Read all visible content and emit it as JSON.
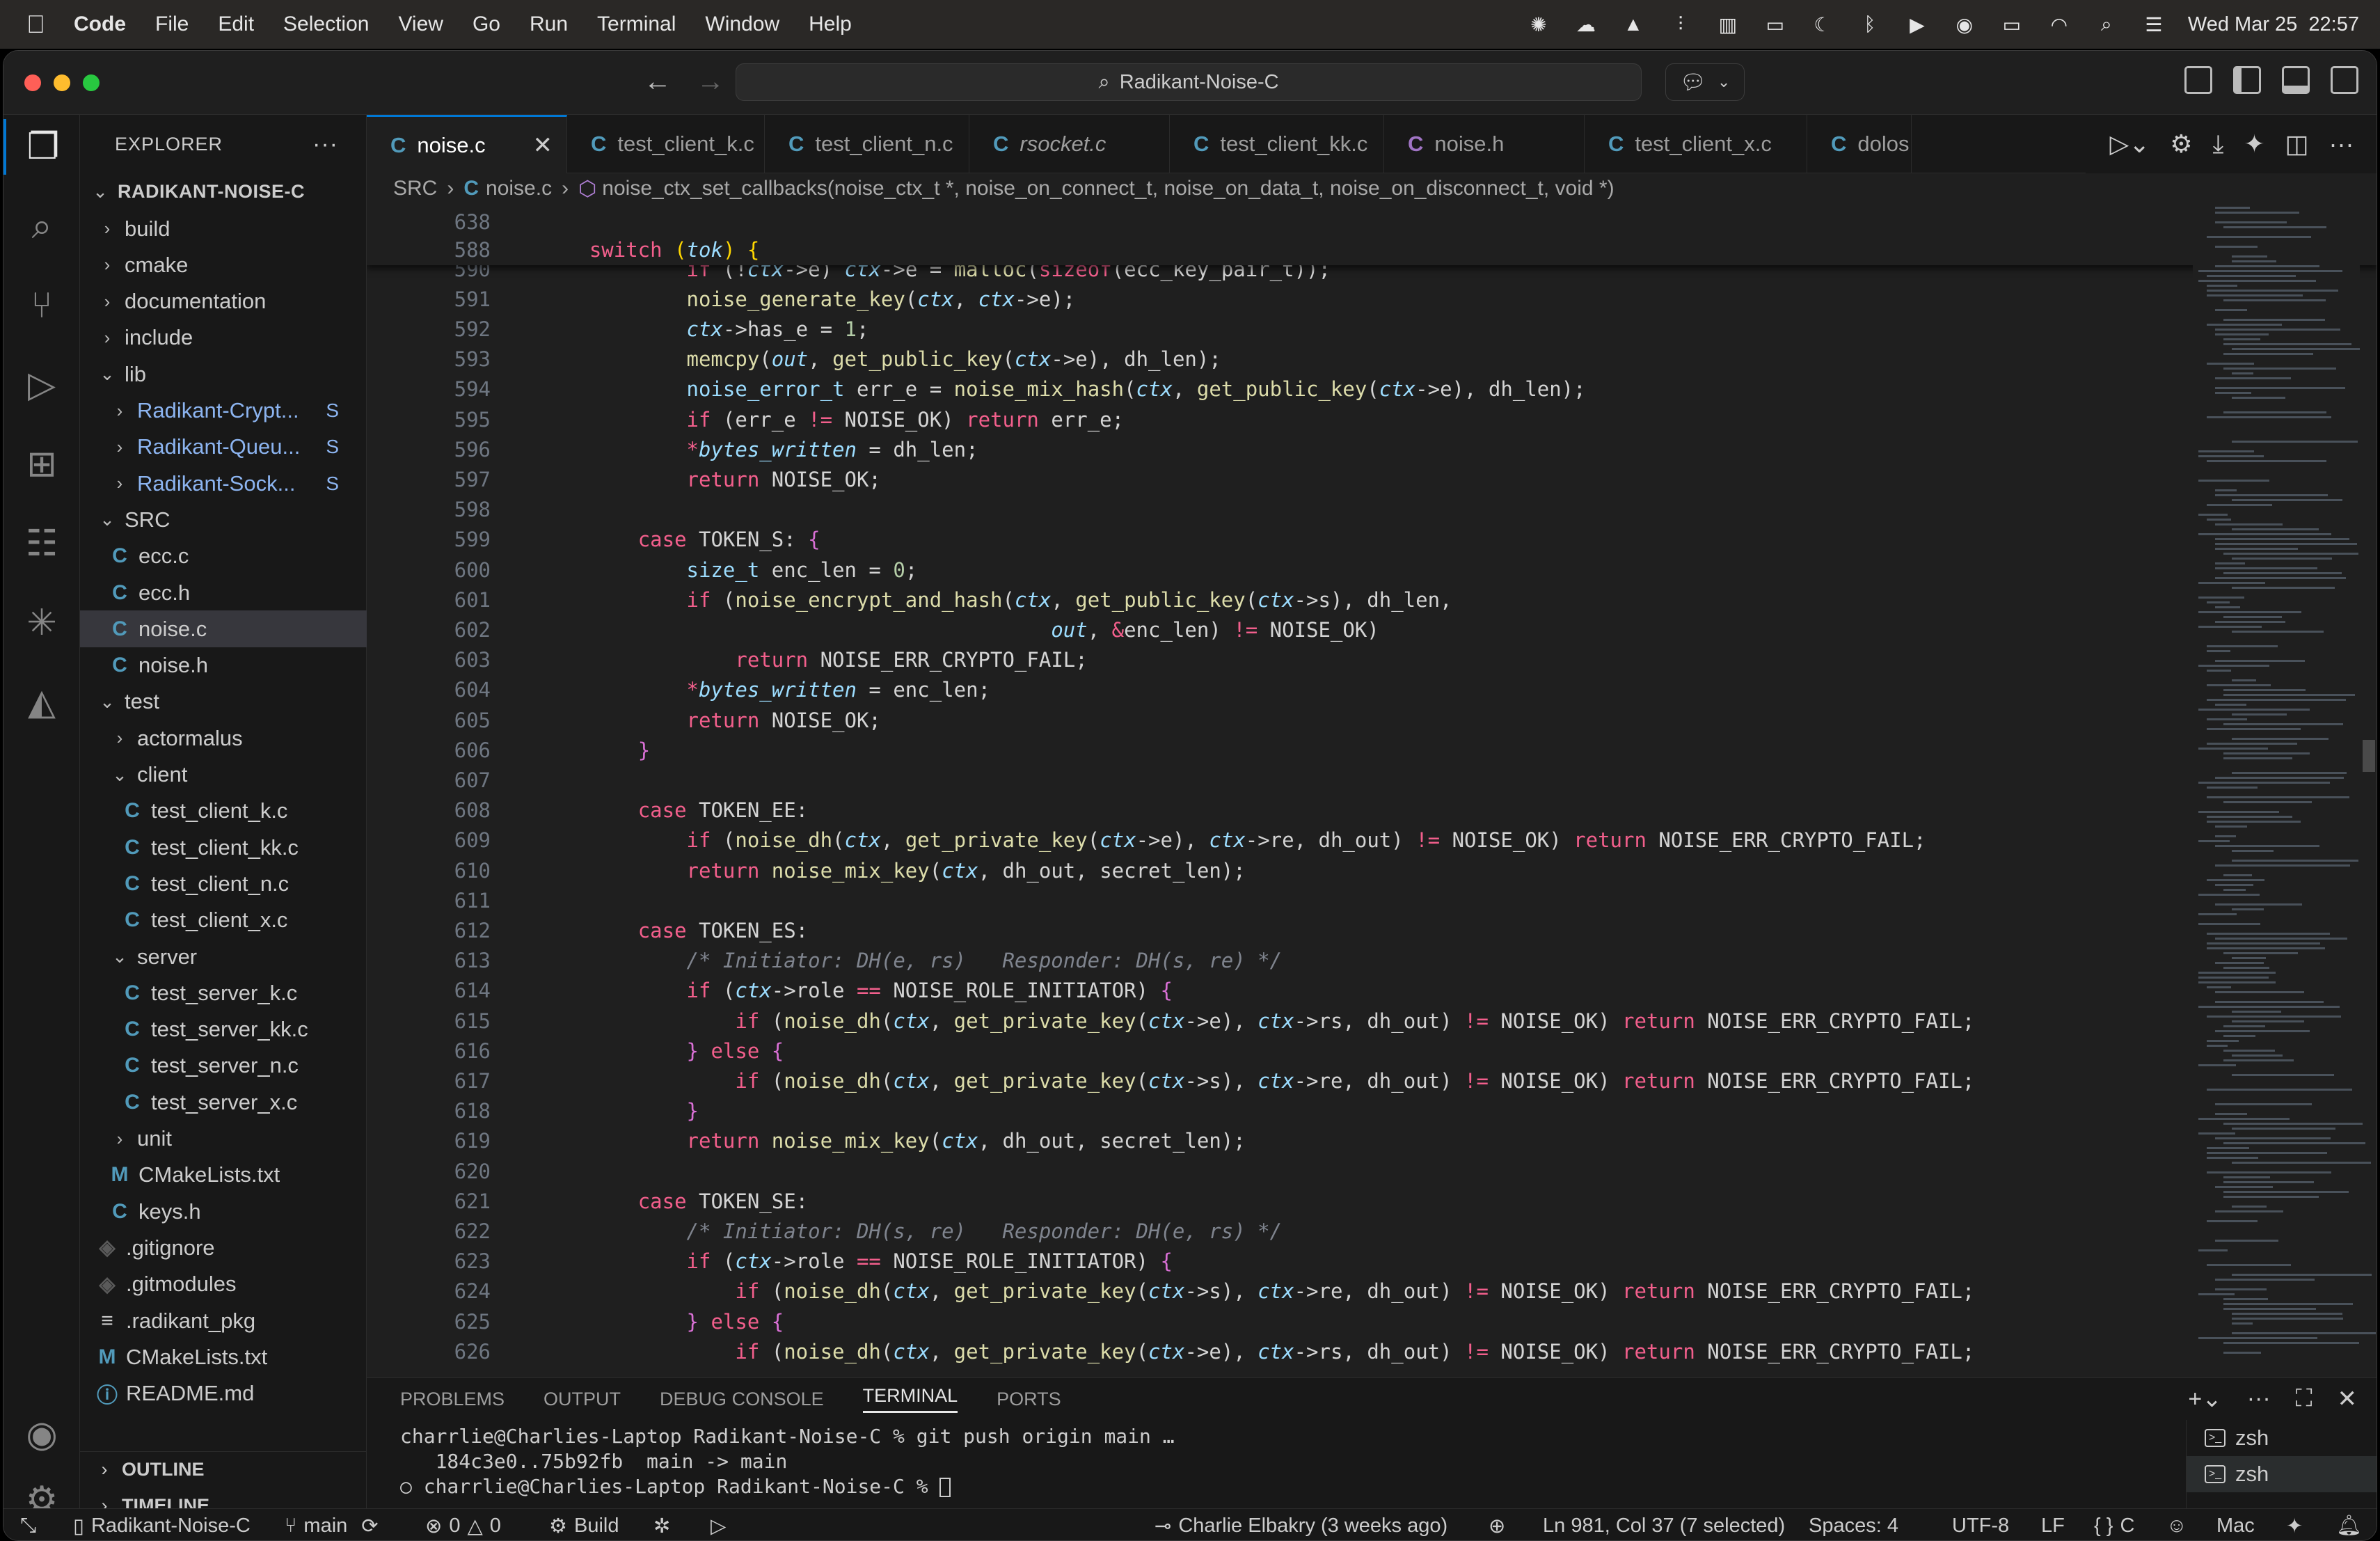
{
  "menubar": {
    "app": "Code",
    "items": [
      "File",
      "Edit",
      "Selection",
      "View",
      "Go",
      "Run",
      "Terminal",
      "Window",
      "Help"
    ],
    "datetime": "Wed Mar 25  22:57"
  },
  "titlebar": {
    "search_text": "Radikant-Noise-C"
  },
  "sidebar": {
    "title": "EXPLORER",
    "root": "RADIKANT-NOISE-C",
    "tree": [
      {
        "label": "build",
        "type": "folder",
        "depth": 0,
        "open": false
      },
      {
        "label": "cmake",
        "type": "folder",
        "depth": 0,
        "open": false
      },
      {
        "label": "documentation",
        "type": "folder",
        "depth": 0,
        "open": false
      },
      {
        "label": "include",
        "type": "folder",
        "depth": 0,
        "open": false
      },
      {
        "label": "lib",
        "type": "folder",
        "depth": 0,
        "open": true
      },
      {
        "label": "Radikant-Crypt...",
        "type": "submodule",
        "depth": 1,
        "open": false,
        "badge": "S"
      },
      {
        "label": "Radikant-Queu...",
        "type": "submodule",
        "depth": 1,
        "open": false,
        "badge": "S"
      },
      {
        "label": "Radikant-Sock...",
        "type": "submodule",
        "depth": 1,
        "open": false,
        "badge": "S"
      },
      {
        "label": "SRC",
        "type": "folder",
        "depth": 0,
        "open": true
      },
      {
        "label": "ecc.c",
        "type": "c",
        "depth": 1
      },
      {
        "label": "ecc.h",
        "type": "c",
        "depth": 1
      },
      {
        "label": "noise.c",
        "type": "c",
        "depth": 1,
        "selected": true
      },
      {
        "label": "noise.h",
        "type": "c",
        "depth": 1
      },
      {
        "label": "test",
        "type": "folder",
        "depth": 0,
        "open": true
      },
      {
        "label": "actormalus",
        "type": "folder",
        "depth": 1,
        "open": false
      },
      {
        "label": "client",
        "type": "folder",
        "depth": 1,
        "open": true
      },
      {
        "label": "test_client_k.c",
        "type": "c",
        "depth": 2
      },
      {
        "label": "test_client_kk.c",
        "type": "c",
        "depth": 2
      },
      {
        "label": "test_client_n.c",
        "type": "c",
        "depth": 2
      },
      {
        "label": "test_client_x.c",
        "type": "c",
        "depth": 2
      },
      {
        "label": "server",
        "type": "folder",
        "depth": 1,
        "open": true
      },
      {
        "label": "test_server_k.c",
        "type": "c",
        "depth": 2
      },
      {
        "label": "test_server_kk.c",
        "type": "c",
        "depth": 2
      },
      {
        "label": "test_server_n.c",
        "type": "c",
        "depth": 2
      },
      {
        "label": "test_server_x.c",
        "type": "c",
        "depth": 2
      },
      {
        "label": "unit",
        "type": "folder",
        "depth": 1,
        "open": false
      },
      {
        "label": "CMakeLists.txt",
        "type": "m",
        "depth": 1
      },
      {
        "label": "keys.h",
        "type": "c",
        "depth": 1
      },
      {
        "label": ".gitignore",
        "type": "git",
        "depth": 0
      },
      {
        "label": ".gitmodules",
        "type": "git",
        "depth": 0
      },
      {
        "label": ".radikant_pkg",
        "type": "eq",
        "depth": 0
      },
      {
        "label": "CMakeLists.txt",
        "type": "m",
        "depth": 0
      },
      {
        "label": "README.md",
        "type": "info",
        "depth": 0
      }
    ],
    "outline_label": "OUTLINE",
    "timeline_label": "TIMELINE"
  },
  "tabs": [
    {
      "label": "noise.c",
      "active": true,
      "italic": false
    },
    {
      "label": "test_client_k.c",
      "active": false,
      "italic": false
    },
    {
      "label": "test_client_n.c",
      "active": false,
      "italic": false
    },
    {
      "label": "rsocket.c",
      "active": false,
      "italic": true
    },
    {
      "label": "test_client_kk.c",
      "active": false,
      "italic": false
    },
    {
      "label": "noise.h",
      "active": false,
      "italic": false
    },
    {
      "label": "test_client_x.c",
      "active": false,
      "italic": false
    },
    {
      "label": "dolos",
      "active": false,
      "italic": false
    }
  ],
  "breadcrumb": {
    "folder": "SRC",
    "file": "noise.c",
    "symbol": "noise_ctx_set_callbacks(noise_ctx_t *, noise_on_connect_t, noise_on_data_t, noise_on_disconnect_t, void *)"
  },
  "editor": {
    "sticky": [
      {
        "n": "638",
        "html": ""
      },
      {
        "n": "588",
        "html": "    <span class='kw'>switch</span> <span class='brace'>(</span><span class='var'>tok</span><span class='brace'>)</span> <span class='brace'>{</span>"
      }
    ],
    "lines": [
      {
        "n": "590",
        "html": "            <span class='kw'>if</span> (!<span class='var'>ctx</span>-&gt;e) <span class='var'>ctx</span>-&gt;e = <span class='fn'>malloc</span>(<span class='kw'>sizeof</span>(ecc_key_pair_t));"
      },
      {
        "n": "591",
        "html": "            <span class='fn'>noise_generate_key</span>(<span class='var'>ctx</span>, <span class='var'>ctx</span>-&gt;e);"
      },
      {
        "n": "592",
        "html": "            <span class='var'>ctx</span>-&gt;has_e = <span class='num'>1</span>;"
      },
      {
        "n": "593",
        "html": "            <span class='fn'>memcpy</span>(<span class='var'>out</span>, <span class='fn'>get_public_key</span>(<span class='var'>ctx</span>-&gt;e), dh_len);"
      },
      {
        "n": "594",
        "html": "            <span class='ty'>noise_error_t</span> err_e = <span class='fn'>noise_mix_hash</span>(<span class='var'>ctx</span>, <span class='fn'>get_public_key</span>(<span class='var'>ctx</span>-&gt;e), dh_len);"
      },
      {
        "n": "595",
        "html": "            <span class='kw'>if</span> (err_e <span class='kw'>!=</span> NOISE_OK) <span class='kw'>return</span> err_e;"
      },
      {
        "n": "596",
        "html": "            <span class='kw'>*</span><span class='var'>bytes_written</span> = dh_len;"
      },
      {
        "n": "597",
        "html": "            <span class='kw'>return</span> NOISE_OK;"
      },
      {
        "n": "598",
        "html": ""
      },
      {
        "n": "599",
        "html": "        <span class='kw'>case</span> TOKEN_S: <span class='brace2'>{</span>"
      },
      {
        "n": "600",
        "html": "            <span class='ty'>size_t</span> enc_len = <span class='num'>0</span>;"
      },
      {
        "n": "601",
        "html": "            <span class='kw'>if</span> (<span class='fn'>noise_encrypt_and_hash</span>(<span class='var'>ctx</span>, <span class='fn'>get_public_key</span>(<span class='var'>ctx</span>-&gt;s), dh_len,"
      },
      {
        "n": "602",
        "html": "                                          <span class='var'>out</span>, <span class='kw'>&amp;</span>enc_len) <span class='kw'>!=</span> NOISE_OK)"
      },
      {
        "n": "603",
        "html": "                <span class='kw'>return</span> NOISE_ERR_CRYPTO_FAIL;"
      },
      {
        "n": "604",
        "html": "            <span class='kw'>*</span><span class='var'>bytes_written</span> = enc_len;"
      },
      {
        "n": "605",
        "html": "            <span class='kw'>return</span> NOISE_OK;"
      },
      {
        "n": "606",
        "html": "        <span class='brace2'>}</span>"
      },
      {
        "n": "607",
        "html": ""
      },
      {
        "n": "608",
        "html": "        <span class='kw'>case</span> TOKEN_EE:"
      },
      {
        "n": "609",
        "html": "            <span class='kw'>if</span> (<span class='fn'>noise_dh</span>(<span class='var'>ctx</span>, <span class='fn'>get_private_key</span>(<span class='var'>ctx</span>-&gt;e), <span class='var'>ctx</span>-&gt;re, dh_out) <span class='kw'>!=</span> NOISE_OK) <span class='kw'>return</span> NOISE_ERR_CRYPTO_FAIL;"
      },
      {
        "n": "610",
        "html": "            <span class='kw'>return</span> <span class='fn'>noise_mix_key</span>(<span class='var'>ctx</span>, dh_out, secret_len);"
      },
      {
        "n": "611",
        "html": ""
      },
      {
        "n": "612",
        "html": "        <span class='kw'>case</span> TOKEN_ES:"
      },
      {
        "n": "613",
        "html": "            <span class='cm'>/* Initiator: DH(e, rs)   Responder: DH(s, re) */</span>"
      },
      {
        "n": "614",
        "html": "            <span class='kw'>if</span> (<span class='var'>ctx</span>-&gt;role <span class='kw'>==</span> NOISE_ROLE_INITIATOR) <span class='brace2'>{</span>"
      },
      {
        "n": "615",
        "html": "                <span class='kw'>if</span> (<span class='fn'>noise_dh</span>(<span class='var'>ctx</span>, <span class='fn'>get_private_key</span>(<span class='var'>ctx</span>-&gt;e), <span class='var'>ctx</span>-&gt;rs, dh_out) <span class='kw'>!=</span> NOISE_OK) <span class='kw'>return</span> NOISE_ERR_CRYPTO_FAIL;"
      },
      {
        "n": "616",
        "html": "            <span class='brace2'>}</span> <span class='kw'>else</span> <span class='brace2'>{</span>"
      },
      {
        "n": "617",
        "html": "                <span class='kw'>if</span> (<span class='fn'>noise_dh</span>(<span class='var'>ctx</span>, <span class='fn'>get_private_key</span>(<span class='var'>ctx</span>-&gt;s), <span class='var'>ctx</span>-&gt;re, dh_out) <span class='kw'>!=</span> NOISE_OK) <span class='kw'>return</span> NOISE_ERR_CRYPTO_FAIL;"
      },
      {
        "n": "618",
        "html": "            <span class='brace2'>}</span>"
      },
      {
        "n": "619",
        "html": "            <span class='kw'>return</span> <span class='fn'>noise_mix_key</span>(<span class='var'>ctx</span>, dh_out, secret_len);"
      },
      {
        "n": "620",
        "html": ""
      },
      {
        "n": "621",
        "html": "        <span class='kw'>case</span> TOKEN_SE:"
      },
      {
        "n": "622",
        "html": "            <span class='cm'>/* Initiator: DH(s, re)   Responder: DH(e, rs) */</span>"
      },
      {
        "n": "623",
        "html": "            <span class='kw'>if</span> (<span class='var'>ctx</span>-&gt;role <span class='kw'>==</span> NOISE_ROLE_INITIATOR) <span class='brace2'>{</span>"
      },
      {
        "n": "624",
        "html": "                <span class='kw'>if</span> (<span class='fn'>noise_dh</span>(<span class='var'>ctx</span>, <span class='fn'>get_private_key</span>(<span class='var'>ctx</span>-&gt;s), <span class='var'>ctx</span>-&gt;re, dh_out) <span class='kw'>!=</span> NOISE_OK) <span class='kw'>return</span> NOISE_ERR_CRYPTO_FAIL;"
      },
      {
        "n": "625",
        "html": "            <span class='brace2'>}</span> <span class='kw'>else</span> <span class='brace2'>{</span>"
      },
      {
        "n": "626",
        "html": "                <span class='kw'>if</span> (<span class='fn'>noise_dh</span>(<span class='var'>ctx</span>, <span class='fn'>get_private_key</span>(<span class='var'>ctx</span>-&gt;e), <span class='var'>ctx</span>-&gt;rs, dh_out) <span class='kw'>!=</span> NOISE_OK) <span class='kw'>return</span> NOISE_ERR_CRYPTO_FAIL;"
      }
    ]
  },
  "panel": {
    "tabs": [
      "PROBLEMS",
      "OUTPUT",
      "DEBUG CONSOLE",
      "TERMINAL",
      "PORTS"
    ],
    "active_tab": "TERMINAL",
    "terminal_lines": [
      "charrlie@Charlies-Laptop Radikant-Noise-C % git push origin main …",
      "   184c3e0..75b92fb  main -> main",
      "○ charrlie@Charlies-Laptop Radikant-Noise-C % "
    ],
    "terminals": [
      "zsh",
      "zsh"
    ]
  },
  "statusbar": {
    "remote": "Radikant-Noise-C",
    "branch": "main",
    "errors": "0",
    "warnings": "0",
    "build": "Build",
    "blame": "Charlie Elbakry (3 weeks ago)",
    "position": "Ln 981, Col 37 (7 selected)",
    "spaces": "Spaces: 4",
    "encoding": "UTF-8",
    "eol": "LF",
    "language": "C",
    "platform": "Mac"
  },
  "colors": {
    "accent": "#0078d4",
    "editor_bg": "#1f1f1f",
    "sidebar_bg": "#181818",
    "keyword": "#f25f8c",
    "function": "#dcdcaa"
  }
}
